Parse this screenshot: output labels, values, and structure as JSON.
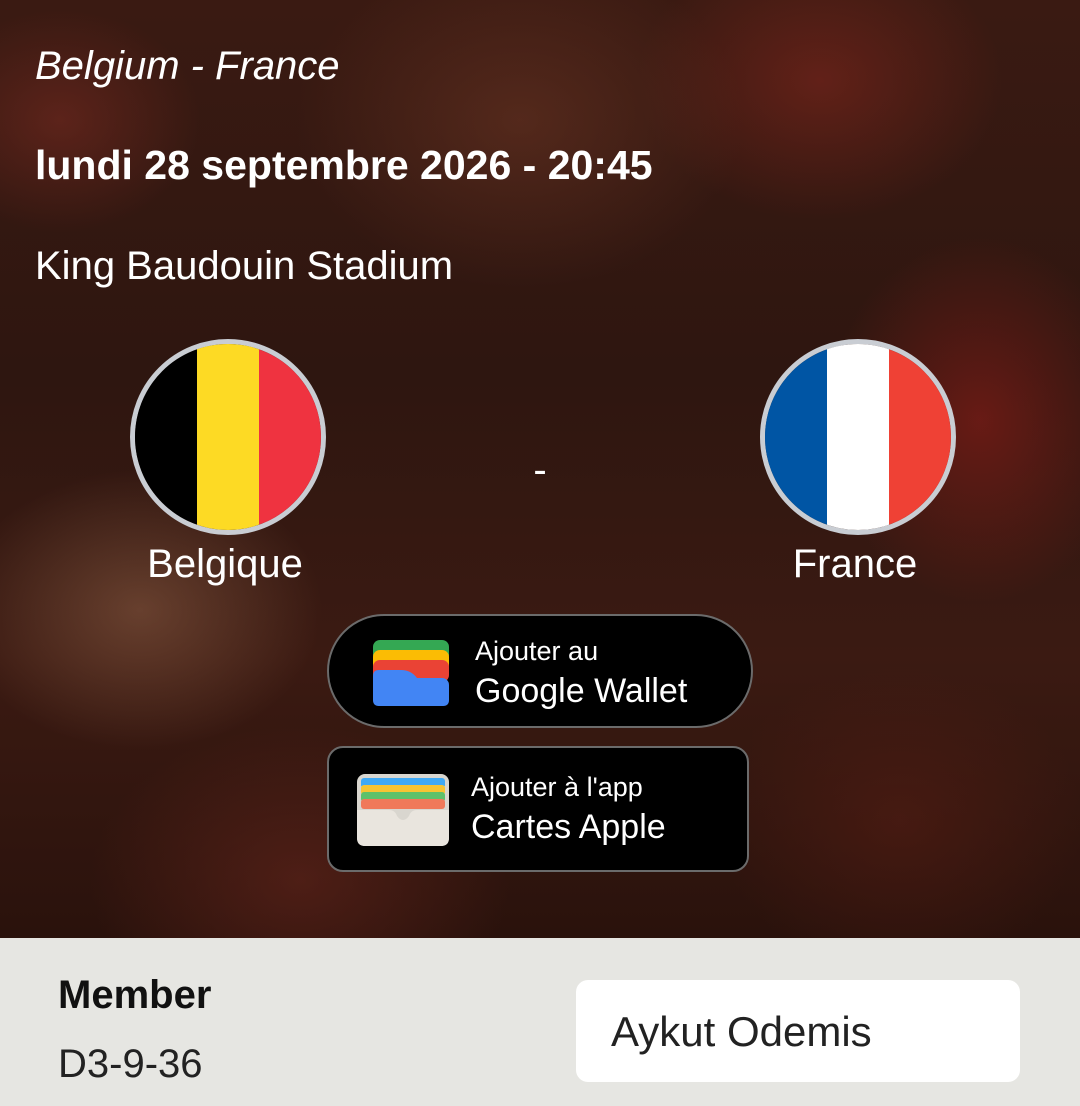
{
  "match": {
    "title": "Belgium - France",
    "datetime": "lundi 28 septembre 2026 - 20:45",
    "venue": "King Baudouin Stadium",
    "separator": "-"
  },
  "teams": {
    "home": {
      "name": "Belgique",
      "flag_icon": "belgium-flag-icon",
      "colors": [
        "#000000",
        "#FDDA24",
        "#EF3340"
      ]
    },
    "away": {
      "name": "France",
      "flag_icon": "france-flag-icon",
      "colors": [
        "#0055A4",
        "#FFFFFF",
        "#EF4135"
      ]
    }
  },
  "wallet_buttons": {
    "google": {
      "line1": "Ajouter au",
      "line2": "Google Wallet",
      "icon": "google-wallet-icon"
    },
    "apple": {
      "line1": "Ajouter à l'app",
      "line2": "Cartes Apple",
      "icon": "apple-wallet-icon"
    }
  },
  "member": {
    "label": "Member",
    "code": "D3-9-36",
    "name": "Aykut Odemis"
  }
}
